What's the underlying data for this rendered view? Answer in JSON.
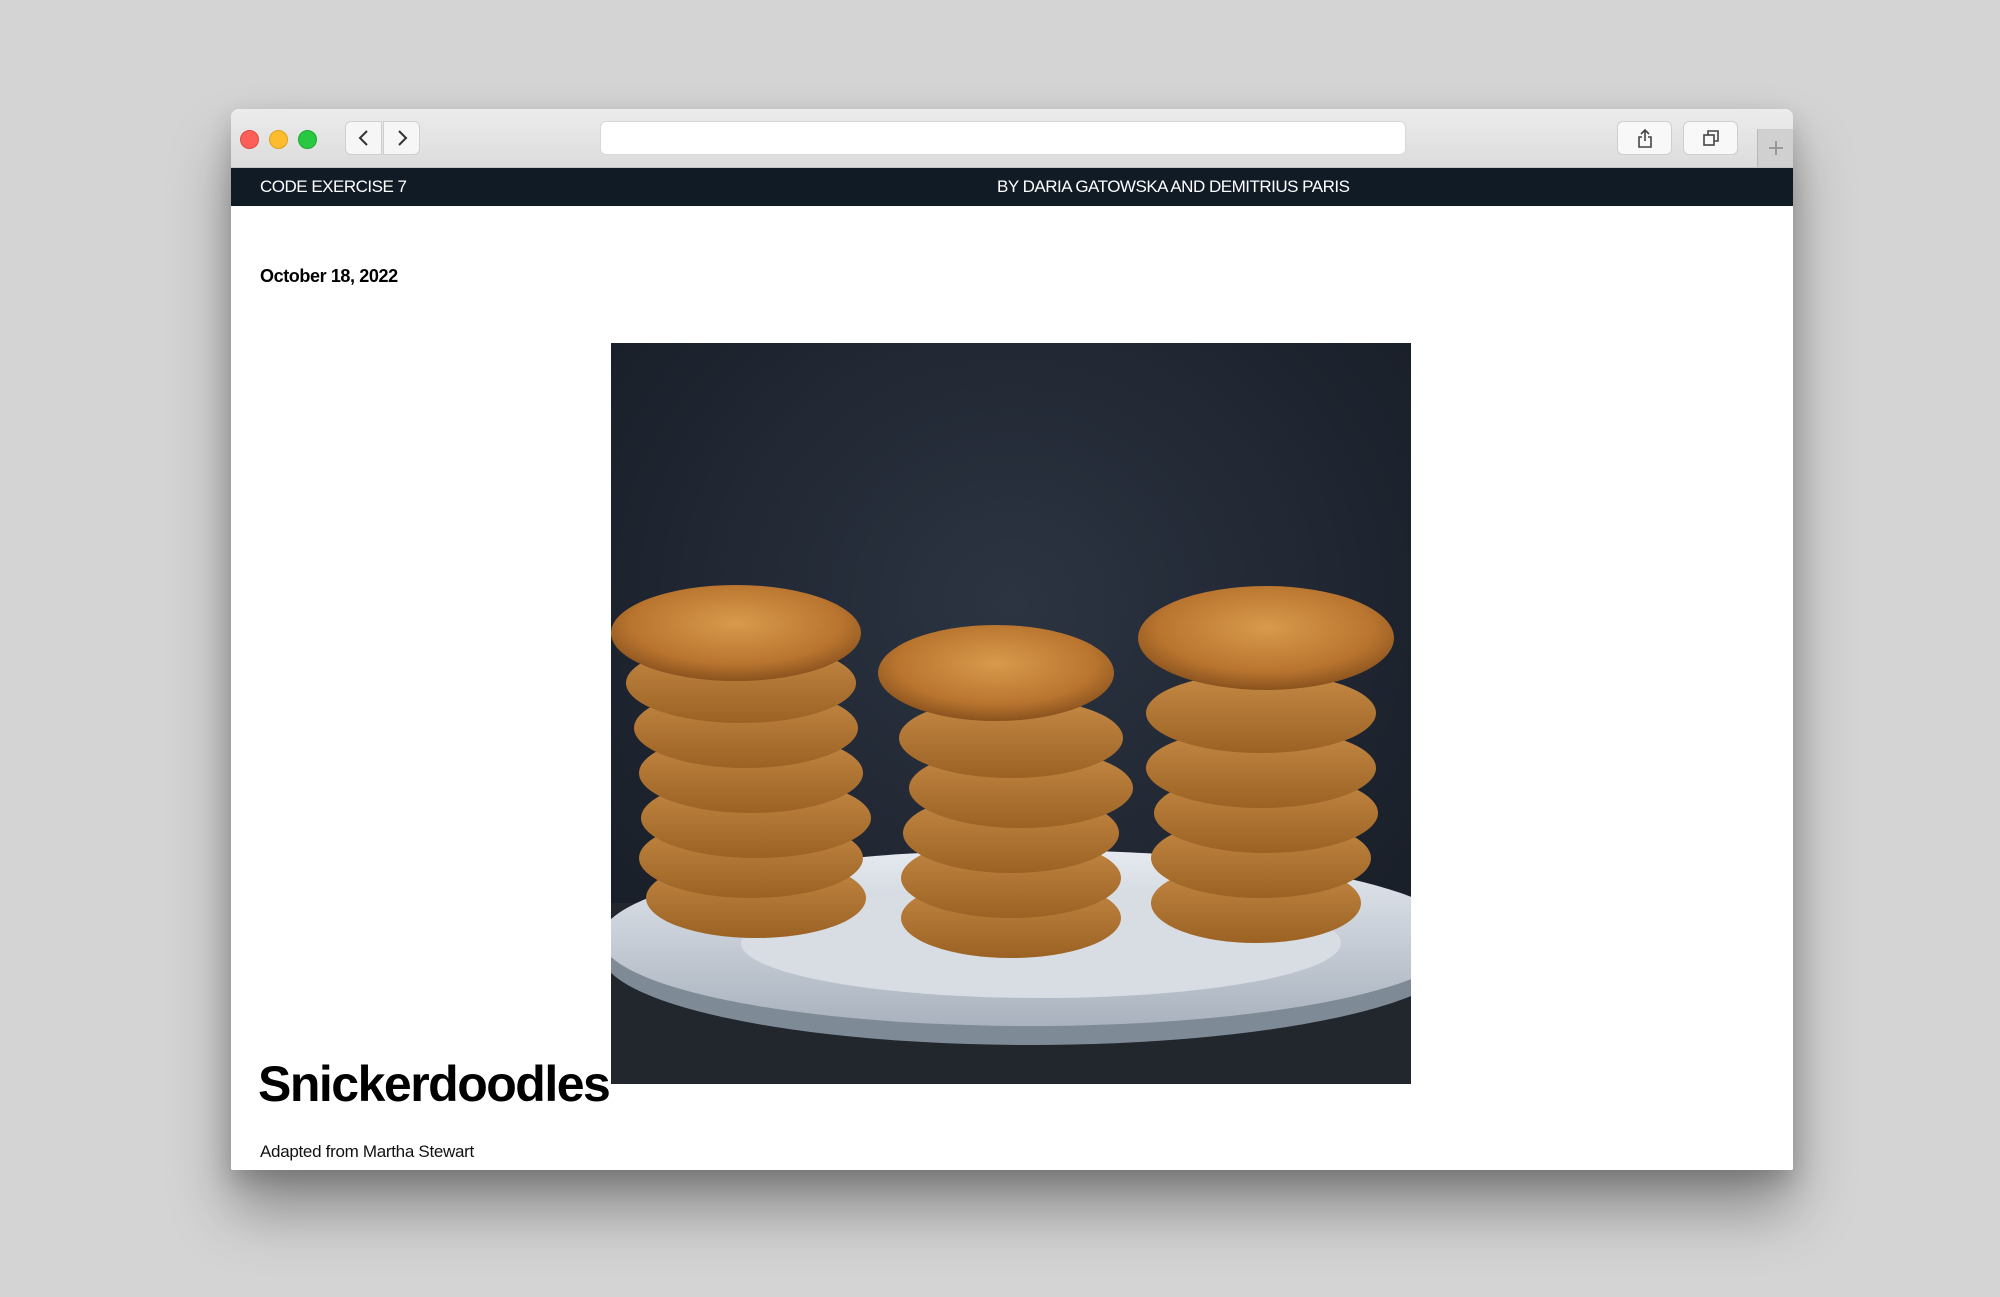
{
  "browser": {
    "address": ""
  },
  "site": {
    "left_title": "CODE EXERCISE 7",
    "byline": "BY DARIA GATOWSKA AND DEMITRIUS PARIS"
  },
  "article": {
    "date": "October 18, 2022",
    "image_subject": "stacks of snickerdoodle cookies on a white plate",
    "title": "Snickerdoodles",
    "source": "Adapted from Martha Stewart"
  },
  "colors": {
    "sitebar": "#111b26",
    "page_bg": "#d4d4d4"
  }
}
